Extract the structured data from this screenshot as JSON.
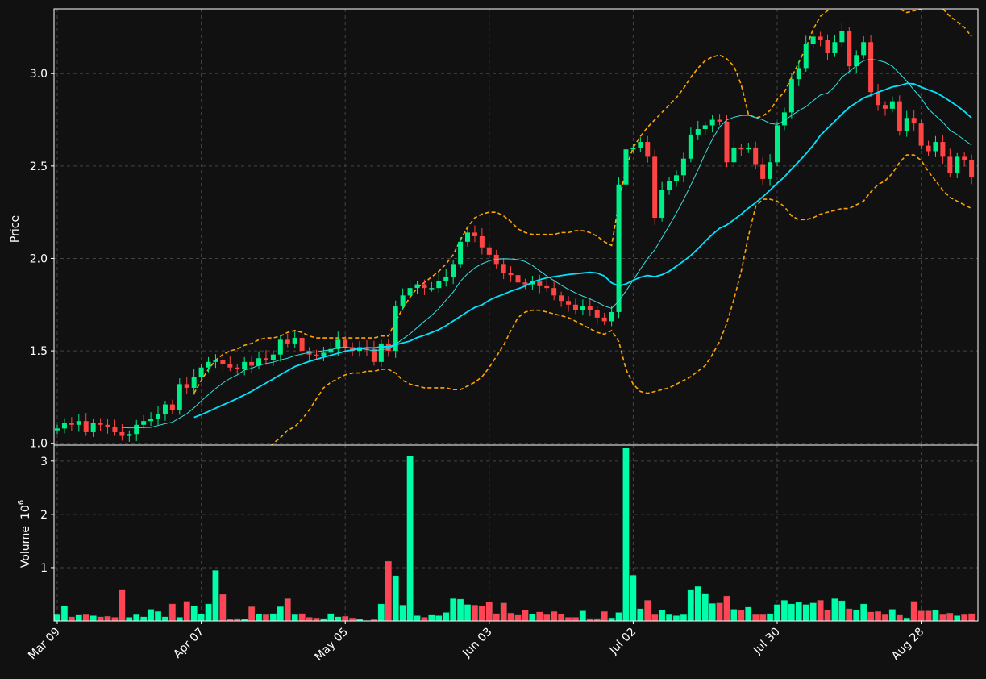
{
  "chart_data": {
    "type": "candlestick",
    "colors": {
      "background": "#111111",
      "up": "#00ee88",
      "down": "#ff4444",
      "volume_up": "#00ffaa",
      "volume_down": "#ff4455",
      "ma_fast": "#33e0e0",
      "ma_slow": "#00e5ff",
      "bollinger": "#ffa500",
      "grid": "#444444",
      "axis": "#ffffff"
    },
    "grid": true,
    "price_panel": {
      "ylabel": "Price",
      "ylim": [
        0.99,
        3.35
      ],
      "yticks": [
        1.0,
        1.5,
        2.0,
        2.5,
        3.0
      ],
      "ytick_labels": [
        "1.0",
        "1.5",
        "2.0",
        "2.5",
        "3.0"
      ]
    },
    "volume_panel": {
      "ylabel": "Volume",
      "ylabel_exponent": "10",
      "ylabel_exponent_power": "6",
      "ylim": [
        0,
        3.3
      ],
      "yticks": [
        1,
        2,
        3
      ],
      "ytick_labels": [
        "1",
        "2",
        "3"
      ]
    },
    "x_tick_labels": [
      {
        "index": 0,
        "label": "Mar 09"
      },
      {
        "index": 20,
        "label": "Apr 07"
      },
      {
        "index": 40,
        "label": "May 05"
      },
      {
        "index": 60,
        "label": "Jun 03"
      },
      {
        "index": 80,
        "label": "Jul 02"
      },
      {
        "index": 100,
        "label": "Jul 30"
      },
      {
        "index": 120,
        "label": "Aug 28"
      }
    ],
    "n_bars": 128,
    "close": [
      1.08,
      1.11,
      1.1,
      1.12,
      1.06,
      1.11,
      1.1,
      1.09,
      1.06,
      1.04,
      1.05,
      1.1,
      1.12,
      1.13,
      1.16,
      1.21,
      1.18,
      1.32,
      1.3,
      1.36,
      1.41,
      1.44,
      1.45,
      1.43,
      1.41,
      1.4,
      1.44,
      1.42,
      1.46,
      1.45,
      1.48,
      1.56,
      1.54,
      1.57,
      1.5,
      1.48,
      1.47,
      1.49,
      1.51,
      1.56,
      1.52,
      1.5,
      1.52,
      1.51,
      1.44,
      1.54,
      1.5,
      1.74,
      1.8,
      1.84,
      1.86,
      1.84,
      1.84,
      1.88,
      1.9,
      1.97,
      2.09,
      2.14,
      2.12,
      2.06,
      2.02,
      1.97,
      1.92,
      1.91,
      1.87,
      1.86,
      1.88,
      1.85,
      1.84,
      1.8,
      1.77,
      1.75,
      1.72,
      1.74,
      1.72,
      1.68,
      1.66,
      1.71,
      2.4,
      2.59,
      2.6,
      2.63,
      2.55,
      2.22,
      2.37,
      2.42,
      2.45,
      2.54,
      2.67,
      2.7,
      2.72,
      2.75,
      2.74,
      2.52,
      2.6,
      2.59,
      2.6,
      2.51,
      2.43,
      2.52,
      2.72,
      2.79,
      2.97,
      3.03,
      3.16,
      3.2,
      3.18,
      3.11,
      3.17,
      3.23,
      3.04,
      3.1,
      3.17,
      2.9,
      2.83,
      2.81,
      2.85,
      2.69,
      2.76,
      2.73,
      2.61,
      2.58,
      2.63,
      2.55,
      2.46,
      2.55,
      2.53,
      2.44
    ],
    "ma_fast": [
      null,
      null,
      null,
      null,
      null,
      null,
      null,
      null,
      null,
      1.085,
      1.083,
      1.083,
      1.085,
      1.086,
      1.096,
      1.106,
      1.114,
      1.137,
      1.16,
      1.192,
      1.229,
      1.263,
      1.296,
      1.326,
      1.351,
      1.37,
      1.396,
      1.406,
      1.422,
      1.431,
      1.439,
      1.451,
      1.46,
      1.474,
      1.483,
      1.491,
      1.494,
      1.501,
      1.506,
      1.517,
      1.521,
      1.515,
      1.513,
      1.507,
      1.501,
      1.507,
      1.51,
      1.535,
      1.564,
      1.592,
      1.626,
      1.66,
      1.692,
      1.729,
      1.775,
      1.818,
      1.877,
      1.917,
      1.949,
      1.971,
      1.987,
      1.996,
      1.998,
      1.997,
      1.994,
      1.983,
      1.962,
      1.933,
      1.905,
      1.88,
      1.855,
      1.833,
      1.813,
      1.796,
      1.781,
      1.763,
      1.743,
      1.73,
      1.769,
      1.824,
      1.883,
      1.942,
      1.999,
      2.047,
      2.112,
      2.177,
      2.245,
      2.318,
      2.397,
      2.479,
      2.567,
      2.646,
      2.711,
      2.749,
      2.764,
      2.773,
      2.774,
      2.762,
      2.75,
      2.73,
      2.725,
      2.744,
      2.774,
      2.799,
      2.821,
      2.853,
      2.884,
      2.894,
      2.93,
      2.981,
      3.01,
      3.043,
      3.07,
      3.078,
      3.072,
      3.061,
      3.04,
      3.0,
      2.959,
      2.911,
      2.868,
      2.808,
      2.772,
      2.737,
      2.693,
      2.67,
      2.64,
      2.613
    ],
    "ma_slow": [
      null,
      null,
      null,
      null,
      null,
      null,
      null,
      null,
      null,
      null,
      null,
      null,
      null,
      null,
      null,
      null,
      null,
      null,
      null,
      1.14,
      1.155,
      1.172,
      1.19,
      1.207,
      1.224,
      1.242,
      1.262,
      1.281,
      1.304,
      1.326,
      1.348,
      1.371,
      1.393,
      1.415,
      1.429,
      1.443,
      1.454,
      1.466,
      1.476,
      1.487,
      1.498,
      1.505,
      1.513,
      1.517,
      1.516,
      1.522,
      1.523,
      1.533,
      1.543,
      1.553,
      1.572,
      1.584,
      1.599,
      1.615,
      1.636,
      1.662,
      1.687,
      1.712,
      1.735,
      1.749,
      1.774,
      1.792,
      1.806,
      1.823,
      1.836,
      1.851,
      1.872,
      1.885,
      1.895,
      1.901,
      1.907,
      1.913,
      1.917,
      1.921,
      1.925,
      1.921,
      1.905,
      1.868,
      1.851,
      1.862,
      1.882,
      1.898,
      1.908,
      1.901,
      1.912,
      1.931,
      1.958,
      1.986,
      2.016,
      2.053,
      2.093,
      2.13,
      2.163,
      2.181,
      2.21,
      2.239,
      2.272,
      2.301,
      2.333,
      2.369,
      2.407,
      2.441,
      2.484,
      2.524,
      2.566,
      2.612,
      2.666,
      2.704,
      2.742,
      2.781,
      2.817,
      2.843,
      2.868,
      2.883,
      2.899,
      2.913,
      2.928,
      2.935,
      2.947,
      2.944,
      2.927,
      2.912,
      2.898,
      2.876,
      2.851,
      2.825,
      2.795,
      2.76
    ],
    "bollinger_upper": [
      null,
      null,
      null,
      null,
      null,
      null,
      null,
      null,
      null,
      null,
      null,
      null,
      null,
      null,
      null,
      null,
      null,
      null,
      null,
      1.27,
      1.34,
      1.4,
      1.45,
      1.48,
      1.5,
      1.51,
      1.53,
      1.54,
      1.56,
      1.57,
      1.57,
      1.58,
      1.6,
      1.61,
      1.6,
      1.58,
      1.57,
      1.57,
      1.57,
      1.57,
      1.57,
      1.57,
      1.57,
      1.57,
      1.57,
      1.58,
      1.58,
      1.66,
      1.73,
      1.79,
      1.84,
      1.87,
      1.9,
      1.93,
      1.97,
      2.02,
      2.1,
      2.17,
      2.22,
      2.24,
      2.25,
      2.25,
      2.23,
      2.2,
      2.16,
      2.14,
      2.13,
      2.13,
      2.13,
      2.13,
      2.14,
      2.14,
      2.15,
      2.15,
      2.14,
      2.12,
      2.09,
      2.07,
      2.3,
      2.49,
      2.6,
      2.66,
      2.71,
      2.75,
      2.79,
      2.83,
      2.87,
      2.92,
      2.98,
      3.03,
      3.07,
      3.09,
      3.1,
      3.08,
      3.04,
      2.94,
      2.78,
      2.76,
      2.77,
      2.8,
      2.86,
      2.9,
      2.98,
      3.06,
      3.14,
      3.24,
      3.31,
      3.34,
      3.38,
      3.4,
      3.41,
      3.42,
      3.43,
      3.42,
      3.4,
      3.39,
      3.37,
      3.35,
      3.33,
      3.34,
      3.35,
      3.36,
      3.37,
      3.35,
      3.31,
      3.28,
      3.25,
      3.2
    ],
    "bollinger_lower": [
      null,
      null,
      null,
      null,
      null,
      null,
      null,
      null,
      null,
      null,
      null,
      null,
      null,
      null,
      null,
      null,
      null,
      null,
      null,
      null,
      null,
      null,
      null,
      null,
      null,
      null,
      null,
      null,
      null,
      0.96,
      1.0,
      1.03,
      1.07,
      1.09,
      1.13,
      1.18,
      1.24,
      1.3,
      1.33,
      1.35,
      1.37,
      1.38,
      1.38,
      1.39,
      1.39,
      1.4,
      1.4,
      1.38,
      1.34,
      1.32,
      1.31,
      1.3,
      1.3,
      1.3,
      1.3,
      1.29,
      1.29,
      1.31,
      1.33,
      1.36,
      1.41,
      1.47,
      1.53,
      1.61,
      1.68,
      1.71,
      1.72,
      1.72,
      1.71,
      1.7,
      1.69,
      1.68,
      1.66,
      1.64,
      1.62,
      1.6,
      1.59,
      1.61,
      1.55,
      1.4,
      1.32,
      1.28,
      1.27,
      1.28,
      1.29,
      1.3,
      1.32,
      1.34,
      1.36,
      1.39,
      1.42,
      1.48,
      1.55,
      1.65,
      1.78,
      1.93,
      2.12,
      2.28,
      2.32,
      2.32,
      2.31,
      2.28,
      2.23,
      2.21,
      2.21,
      2.22,
      2.24,
      2.25,
      2.26,
      2.27,
      2.27,
      2.29,
      2.31,
      2.36,
      2.4,
      2.42,
      2.46,
      2.52,
      2.56,
      2.56,
      2.53,
      2.47,
      2.42,
      2.37,
      2.33,
      2.31,
      2.29,
      2.27
    ],
    "volume": [
      0.12,
      0.28,
      0.08,
      0.11,
      0.12,
      0.1,
      0.08,
      0.09,
      0.07,
      0.58,
      0.07,
      0.12,
      0.08,
      0.22,
      0.18,
      0.08,
      0.32,
      0.07,
      0.37,
      0.28,
      0.13,
      0.32,
      0.95,
      0.5,
      0.04,
      0.05,
      0.04,
      0.27,
      0.13,
      0.12,
      0.14,
      0.27,
      0.42,
      0.12,
      0.14,
      0.07,
      0.06,
      0.05,
      0.14,
      0.08,
      0.09,
      0.06,
      0.04,
      0.01,
      0.03,
      0.32,
      1.12,
      0.85,
      0.3,
      3.1,
      0.1,
      0.07,
      0.11,
      0.1,
      0.16,
      0.42,
      0.41,
      0.31,
      0.3,
      0.28,
      0.36,
      0.14,
      0.34,
      0.15,
      0.11,
      0.2,
      0.13,
      0.17,
      0.12,
      0.18,
      0.13,
      0.07,
      0.07,
      0.19,
      0.05,
      0.05,
      0.18,
      0.06,
      0.16,
      3.25,
      0.86,
      0.23,
      0.39,
      0.12,
      0.21,
      0.12,
      0.1,
      0.12,
      0.58,
      0.65,
      0.52,
      0.33,
      0.34,
      0.47,
      0.22,
      0.2,
      0.26,
      0.12,
      0.12,
      0.14,
      0.31,
      0.39,
      0.32,
      0.35,
      0.31,
      0.34,
      0.39,
      0.21,
      0.42,
      0.38,
      0.23,
      0.2,
      0.32,
      0.17,
      0.18,
      0.12,
      0.22,
      0.11,
      0.06,
      0.37,
      0.19,
      0.19,
      0.2,
      0.12,
      0.15,
      0.1,
      0.12,
      0.14
    ]
  }
}
